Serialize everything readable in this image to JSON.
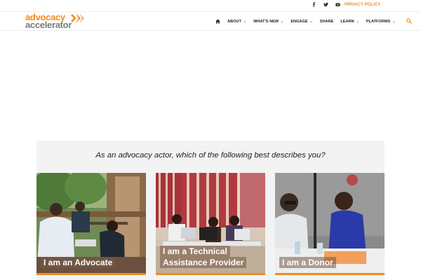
{
  "topbar": {
    "social": [
      {
        "icon": "facebook-icon"
      },
      {
        "icon": "twitter-icon"
      },
      {
        "icon": "youtube-icon"
      }
    ],
    "privacy_label": "PRIVACY POLICY"
  },
  "logo": {
    "line1": "advocacy",
    "line2": "accelerator"
  },
  "nav": {
    "home_icon": "home-icon",
    "items": [
      {
        "label": "ABOUT",
        "dropdown": true
      },
      {
        "label": "WHAT'S NEW",
        "dropdown": true
      },
      {
        "label": "ENGAGE",
        "dropdown": true
      },
      {
        "label": "SHARE",
        "dropdown": false
      },
      {
        "label": "LEARN",
        "dropdown": true
      },
      {
        "label": "PLATFORMS",
        "dropdown": true
      }
    ],
    "search_icon": "search-icon"
  },
  "panel": {
    "question": "As an advocacy actor, which of the following best describes you?",
    "cards": [
      {
        "lines": [
          "I am an Advocate"
        ]
      },
      {
        "lines": [
          "I am a Technical",
          "Assistance Provider"
        ]
      },
      {
        "lines": [
          "I am a Donor"
        ]
      }
    ]
  },
  "colors": {
    "accent": "#ef8a1f",
    "logo_gray": "#7a7a7a",
    "panel_bg": "#f3f3f3"
  }
}
